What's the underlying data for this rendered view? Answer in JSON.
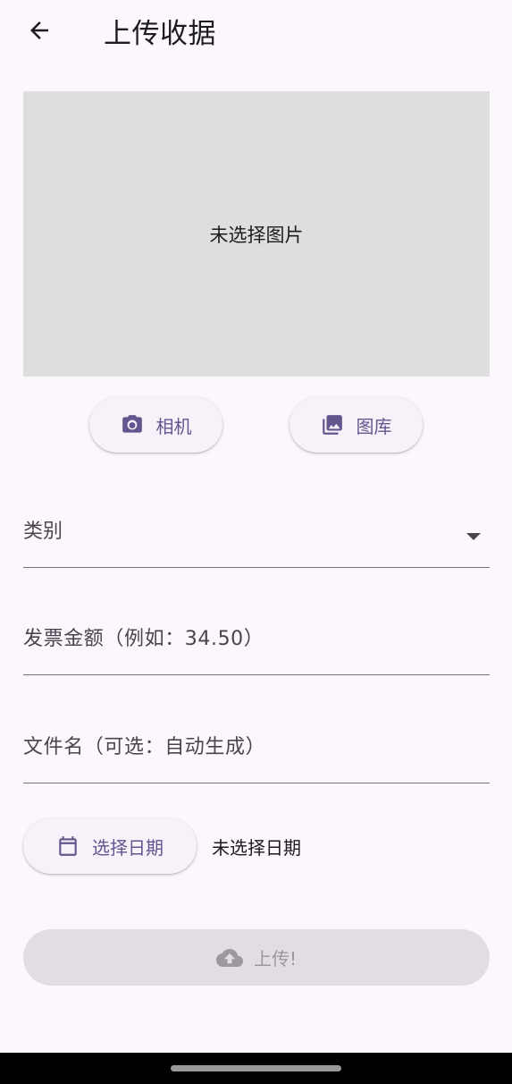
{
  "app_bar": {
    "title": "上传收据",
    "back_icon": "arrow-back-icon"
  },
  "preview": {
    "empty_text": "未选择图片"
  },
  "image_source": {
    "camera_label": "相机",
    "camera_icon": "camera-icon",
    "gallery_label": "图库",
    "gallery_icon": "photo-library-icon"
  },
  "form": {
    "category_label": "类别",
    "category_icon": "dropdown-arrow-icon",
    "amount_placeholder": "发票金额（例如：34.50）",
    "filename_placeholder": "文件名（可选：自动生成）"
  },
  "date": {
    "button_label": "选择日期",
    "button_icon": "calendar-icon",
    "status_text": "未选择日期"
  },
  "upload": {
    "label": "上传!",
    "icon": "cloud-upload-icon",
    "enabled": false
  },
  "colors": {
    "background": "#FCF6FD",
    "accent": "#65558F",
    "preview_bg": "#DFDEDF",
    "disabled_bg": "#E2DCE3",
    "disabled_text": "#9C989E"
  }
}
